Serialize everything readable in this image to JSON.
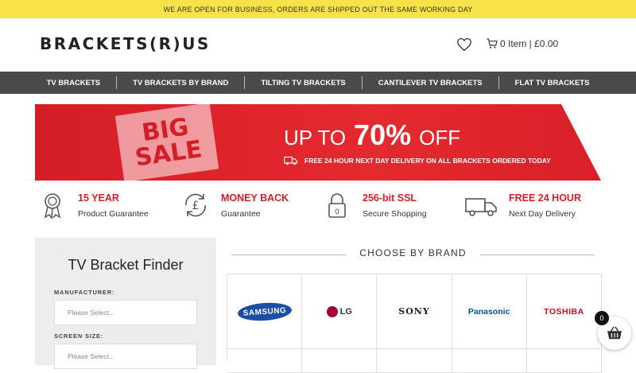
{
  "topbar": {
    "message": "WE ARE OPEN FOR BUSINESS, ORDERS ARE SHIPPED OUT THE SAME WORKING DAY"
  },
  "header": {
    "logo": "BRACKETS(R)US",
    "cart_text": "0 Item | £0.00"
  },
  "nav": {
    "items": [
      "TV BRACKETS",
      "TV BRACKETS BY BRAND",
      "TILTING TV BRACKETS",
      "CANTILEVER TV BRACKETS",
      "FLAT TV BRACKETS"
    ]
  },
  "banner": {
    "sign_line1": "BIG",
    "sign_line2": "SALE",
    "up_to": "UP TO",
    "percent": "70%",
    "off": "OFF",
    "delivery": "FREE 24 HOUR NEXT DAY DELIVERY ON ALL BRACKETS ORDERED TODAY"
  },
  "features": [
    {
      "title": "15 YEAR",
      "subtitle": "Product Guarantee",
      "icon": "award-ribbon-icon"
    },
    {
      "title": "MONEY BACK",
      "subtitle": "Guarantee",
      "icon": "pound-refresh-icon"
    },
    {
      "title": "256-bit SSL",
      "subtitle": "Secure Shopping",
      "icon": "padlock-icon",
      "icon_text": "0"
    },
    {
      "title": "FREE 24 HOUR",
      "subtitle": "Next Day Delivery",
      "icon": "delivery-truck-icon"
    }
  ],
  "finder": {
    "title": "TV Bracket Finder",
    "manufacturer_label": "MANUFACTURER:",
    "manufacturer_placeholder": "Please Select...",
    "screen_label": "SCREEN SIZE:",
    "screen_placeholder": "Please Select..."
  },
  "brands": {
    "title": "CHOOSE BY BRAND",
    "items": [
      {
        "name": "SAMSUNG"
      },
      {
        "name": "LG",
        "mark": "LG"
      },
      {
        "name": "SONY"
      },
      {
        "name": "Panasonic"
      },
      {
        "name": "TOSHIBA"
      }
    ]
  },
  "basket": {
    "count": "0"
  },
  "colors": {
    "accent": "#d41d26",
    "topbar": "#f7e24a",
    "nav": "#4a4a4a"
  }
}
